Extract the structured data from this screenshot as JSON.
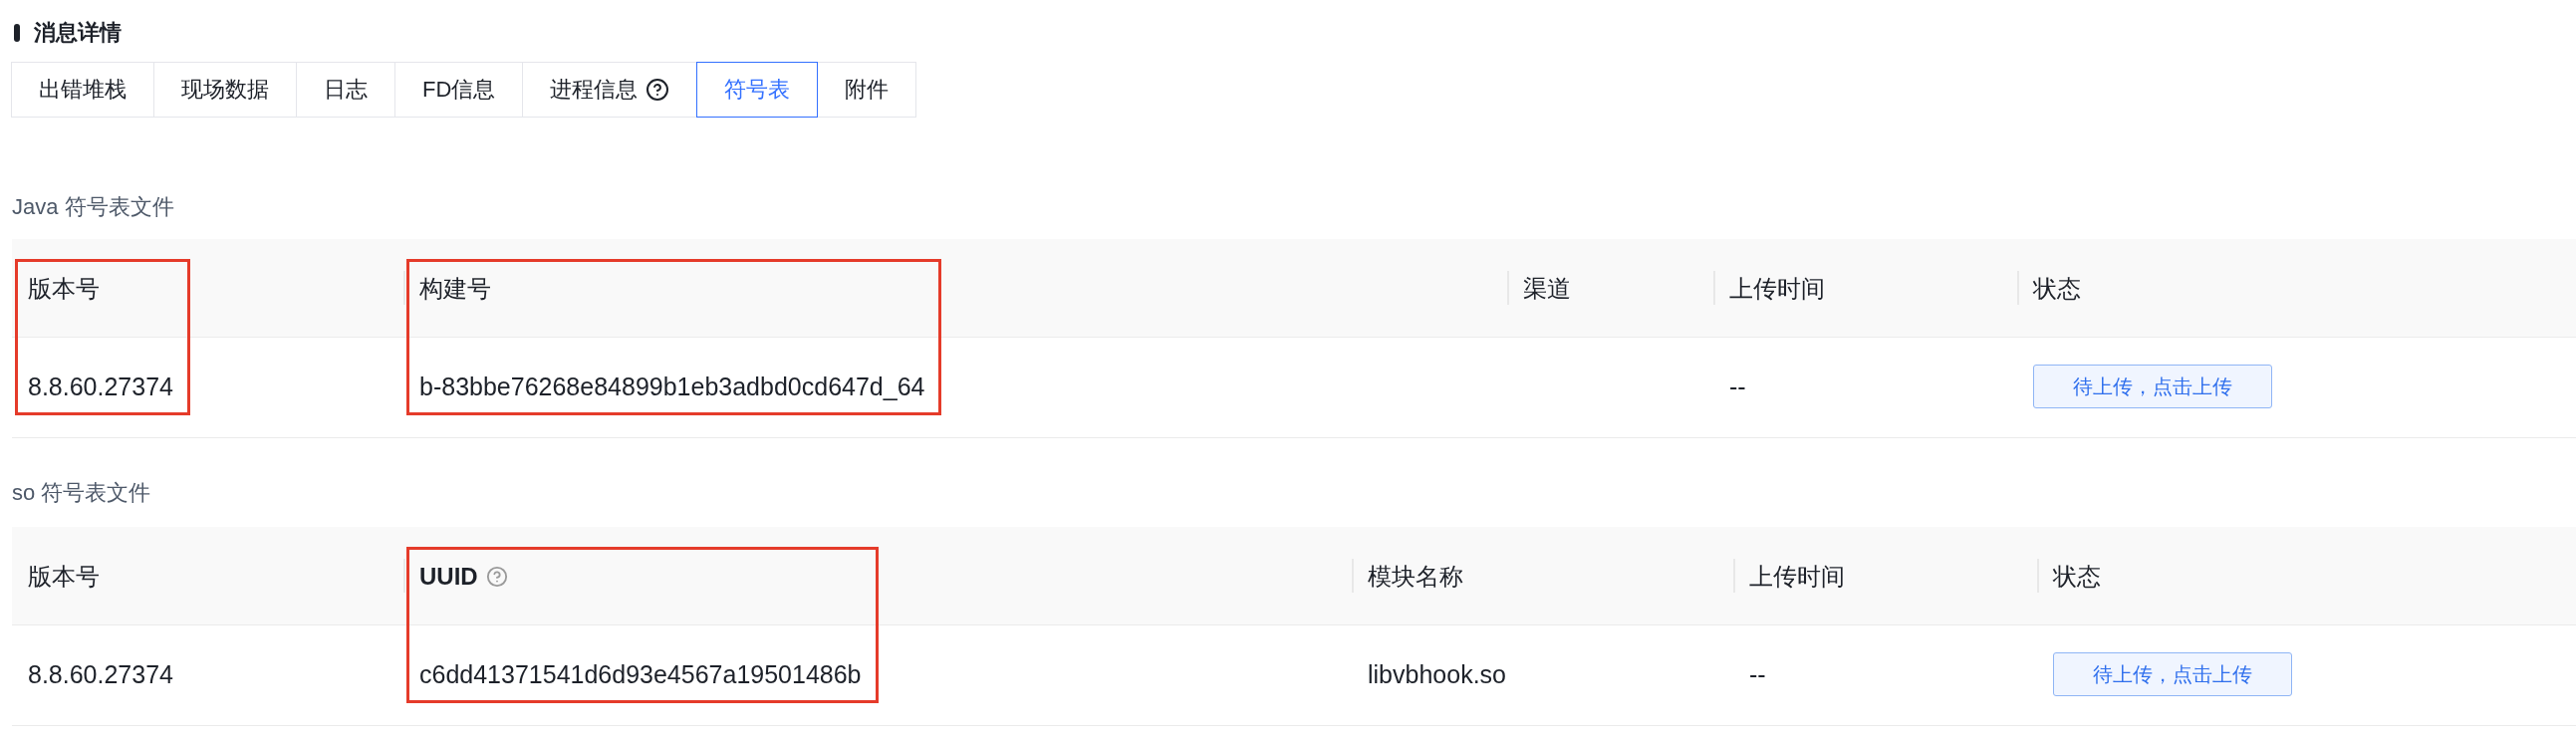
{
  "section_title": "消息详情",
  "tabs": [
    {
      "label": "出错堆栈",
      "selected": false,
      "help": false
    },
    {
      "label": "现场数据",
      "selected": false,
      "help": false
    },
    {
      "label": "日志",
      "selected": false,
      "help": false
    },
    {
      "label": "FD信息",
      "selected": false,
      "help": false
    },
    {
      "label": "进程信息",
      "selected": false,
      "help": true
    },
    {
      "label": "符号表",
      "selected": true,
      "help": false
    },
    {
      "label": "附件",
      "selected": false,
      "help": false
    }
  ],
  "tables": [
    {
      "title": "Java 符号表文件",
      "columns": [
        {
          "label": "版本号",
          "highlighted": true,
          "bold": false,
          "help": false
        },
        {
          "label": "构建号",
          "highlighted": true,
          "bold": false,
          "help": false
        },
        {
          "label": "渠道",
          "highlighted": false,
          "bold": false,
          "help": false
        },
        {
          "label": "上传时间",
          "highlighted": false,
          "bold": false,
          "help": false
        },
        {
          "label": "状态",
          "highlighted": false,
          "bold": false,
          "help": false
        }
      ],
      "rows": [
        {
          "cells": [
            {
              "kind": "text",
              "text": "8.8.60.27374"
            },
            {
              "kind": "text",
              "text": "b-83bbe76268e84899b1eb3adbd0cd647d_64"
            },
            {
              "kind": "empty"
            },
            {
              "kind": "text",
              "text": "--"
            },
            {
              "kind": "button",
              "text": "待上传，点击上传"
            }
          ]
        }
      ]
    },
    {
      "title": "so 符号表文件",
      "columns": [
        {
          "label": "版本号",
          "highlighted": false,
          "bold": false,
          "help": false
        },
        {
          "label": "UUID",
          "highlighted": true,
          "bold": true,
          "help": true
        },
        {
          "label": "模块名称",
          "highlighted": false,
          "bold": false,
          "help": false
        },
        {
          "label": "上传时间",
          "highlighted": false,
          "bold": false,
          "help": false
        },
        {
          "label": "状态",
          "highlighted": false,
          "bold": false,
          "help": false
        }
      ],
      "rows": [
        {
          "cells": [
            {
              "kind": "text",
              "text": "8.8.60.27374"
            },
            {
              "kind": "text",
              "text": "c6dd41371541d6d93e4567a19501486b"
            },
            {
              "kind": "text",
              "text": "libvbhook.so"
            },
            {
              "kind": "text",
              "text": "--"
            },
            {
              "kind": "button",
              "text": "待上传，点击上传"
            }
          ]
        }
      ]
    }
  ]
}
